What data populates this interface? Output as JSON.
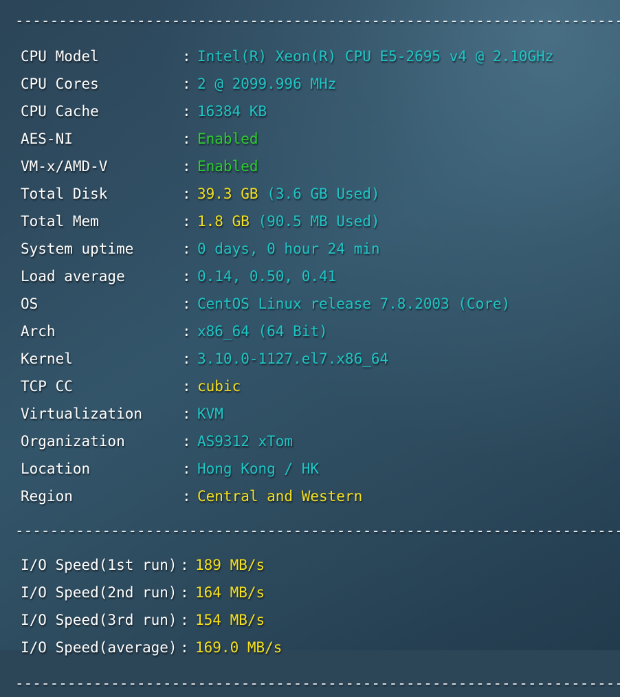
{
  "terminal": {
    "separator_line": "------------------------------------------------------------------------",
    "colon": ":"
  },
  "colors": {
    "background_dark": "#223a4c",
    "background_light": "#35576c",
    "label": "#ffffff",
    "value_cyan": "#1fc6c6",
    "value_green": "#2ece2e",
    "value_yellow": "#f5e01d"
  },
  "system_info": [
    {
      "label": "CPU Model",
      "value": "Intel(R) Xeon(R) CPU E5-2695 v4 @ 2.10GHz",
      "color": "cyan"
    },
    {
      "label": "CPU Cores",
      "value": "2 @ 2099.996 MHz",
      "color": "cyan"
    },
    {
      "label": "CPU Cache",
      "value": "16384 KB",
      "color": "cyan"
    },
    {
      "label": "AES-NI",
      "value": "Enabled",
      "color": "green"
    },
    {
      "label": "VM-x/AMD-V",
      "value": "Enabled",
      "color": "green"
    },
    {
      "label": "Total Disk",
      "value": "39.3 GB",
      "suffix": "(3.6 GB Used)",
      "color": "yellow",
      "suffix_color": "cyan"
    },
    {
      "label": "Total Mem",
      "value": "1.8 GB",
      "suffix": "(90.5 MB Used)",
      "color": "yellow",
      "suffix_color": "cyan"
    },
    {
      "label": "System uptime",
      "value": "0 days, 0 hour 24 min",
      "color": "cyan"
    },
    {
      "label": "Load average",
      "value": "0.14, 0.50, 0.41",
      "color": "cyan"
    },
    {
      "label": "OS",
      "value": "CentOS Linux release 7.8.2003 (Core)",
      "color": "cyan"
    },
    {
      "label": "Arch",
      "value": "x86_64 (64 Bit)",
      "color": "cyan"
    },
    {
      "label": "Kernel",
      "value": "3.10.0-1127.el7.x86_64",
      "color": "cyan"
    },
    {
      "label": "TCP CC",
      "value": "cubic",
      "color": "yellow"
    },
    {
      "label": "Virtualization",
      "value": "KVM",
      "color": "cyan"
    },
    {
      "label": "Organization",
      "value": "AS9312 xTom",
      "color": "cyan"
    },
    {
      "label": "Location",
      "value": "Hong Kong / HK",
      "color": "cyan"
    },
    {
      "label": "Region",
      "value": "Central and Western",
      "color": "yellow"
    }
  ],
  "io_speed": [
    {
      "label": "I/O Speed(1st run)",
      "value": "189 MB/s",
      "color": "yellow"
    },
    {
      "label": "I/O Speed(2nd run)",
      "value": "164 MB/s",
      "color": "yellow"
    },
    {
      "label": "I/O Speed(3rd run)",
      "value": "154 MB/s",
      "color": "yellow"
    },
    {
      "label": "I/O Speed(average)",
      "value": "169.0 MB/s",
      "color": "yellow"
    }
  ]
}
